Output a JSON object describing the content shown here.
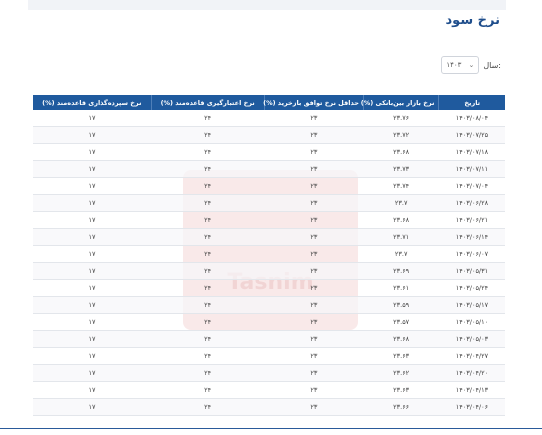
{
  "page": {
    "title": "نرخ سود"
  },
  "filter": {
    "year_label": "سال:",
    "year_value": "۱۴۰۳"
  },
  "table": {
    "headers": [
      "تاریخ",
      "نرخ بازار بین‌بانکی (%)",
      "حداقل نرخ توافق بازخرید (%)",
      "نرخ اعتبارگیری قاعده‌مند (%)",
      "نرخ سپرده‌گذاری قاعده‌مند (%)"
    ],
    "rows": [
      [
        "۱۴۰۳/۰۸/۰۴",
        "۲۳.۷۶",
        "۲۳",
        "۲۴",
        "۱۷"
      ],
      [
        "۱۴۰۳/۰۷/۲۵",
        "۲۳.۷۲",
        "۲۳",
        "۲۴",
        "۱۷"
      ],
      [
        "۱۴۰۳/۰۷/۱۸",
        "۲۳.۶۸",
        "۲۳",
        "۲۴",
        "۱۷"
      ],
      [
        "۱۴۰۳/۰۷/۱۱",
        "۲۳.۷۳",
        "۲۳",
        "۲۴",
        "۱۷"
      ],
      [
        "۱۴۰۳/۰۷/۰۴",
        "۲۳.۷۴",
        "۲۳",
        "۲۴",
        "۱۷"
      ],
      [
        "۱۴۰۳/۰۶/۲۸",
        "۲۳.۷",
        "۲۳",
        "۲۴",
        "۱۷"
      ],
      [
        "۱۴۰۳/۰۶/۲۱",
        "۲۳.۶۸",
        "۲۳",
        "۲۴",
        "۱۷"
      ],
      [
        "۱۴۰۳/۰۶/۱۴",
        "۲۳.۷۱",
        "۲۳",
        "۲۴",
        "۱۷"
      ],
      [
        "۱۴۰۳/۰۶/۰۷",
        "۲۳.۷",
        "۲۳",
        "۲۴",
        "۱۷"
      ],
      [
        "۱۴۰۳/۰۵/۳۱",
        "۲۳.۶۹",
        "۲۳",
        "۲۴",
        "۱۷"
      ],
      [
        "۱۴۰۳/۰۵/۲۴",
        "۲۳.۶۱",
        "۲۳",
        "۲۴",
        "۱۷"
      ],
      [
        "۱۴۰۳/۰۵/۱۷",
        "۲۳.۵۹",
        "۲۳",
        "۲۴",
        "۱۷"
      ],
      [
        "۱۴۰۳/۰۵/۱۰",
        "۲۳.۵۷",
        "۲۳",
        "۲۴",
        "۱۷"
      ],
      [
        "۱۴۰۳/۰۵/۰۳",
        "۲۳.۶۸",
        "۲۳",
        "۲۴",
        "۱۷"
      ],
      [
        "۱۴۰۳/۰۴/۲۷",
        "۲۳.۶۳",
        "۲۳",
        "۲۴",
        "۱۷"
      ],
      [
        "۱۴۰۳/۰۴/۲۰",
        "۲۳.۶۲",
        "۲۳",
        "۲۴",
        "۱۷"
      ],
      [
        "۱۴۰۳/۰۴/۱۳",
        "۲۳.۶۳",
        "۲۳",
        "۲۴",
        "۱۷"
      ],
      [
        "۱۴۰۳/۰۴/۰۶",
        "۲۳.۶۶",
        "۲۳",
        "۲۴",
        "۱۷"
      ]
    ]
  },
  "watermark": {
    "text": "Tasnim"
  },
  "theme": {
    "header_bg": "#1f5a9e",
    "title_color": "#1f4e8c"
  }
}
